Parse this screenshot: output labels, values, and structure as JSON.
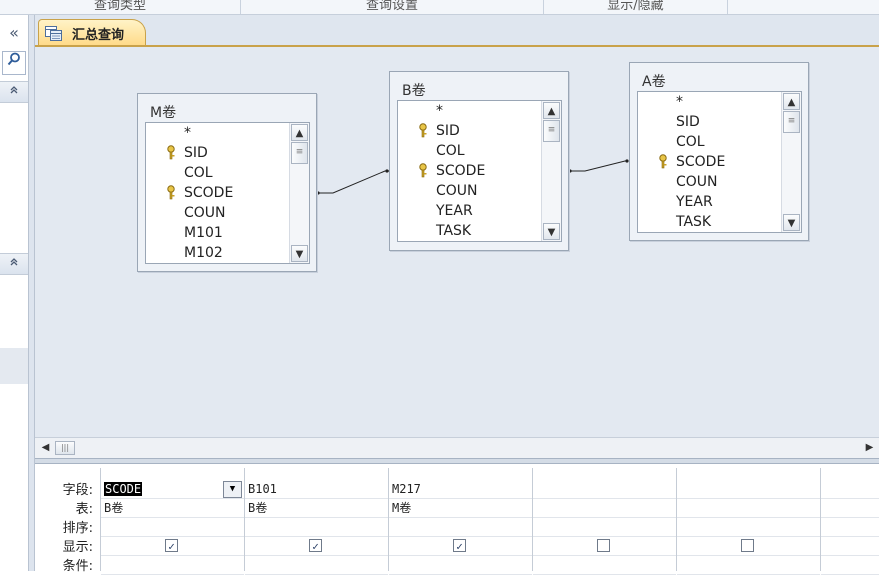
{
  "ribbon": {
    "groups": [
      "查询类型",
      "查询设置",
      "显示/隐藏"
    ]
  },
  "nav": {
    "collapse_icon": "«",
    "search_icon": "search-icon",
    "section_toggle": "⌃"
  },
  "document_tab": {
    "label": "汇总查询",
    "icon": "query-icon"
  },
  "tables": [
    {
      "name": "M卷",
      "fields": [
        "*",
        "SID",
        "COL",
        "SCODE",
        "COUN",
        "M101",
        "M102"
      ],
      "key_fields": [
        "SID",
        "SCODE"
      ]
    },
    {
      "name": "B卷",
      "fields": [
        "*",
        "SID",
        "COL",
        "SCODE",
        "COUN",
        "YEAR",
        "TASK"
      ],
      "key_fields": [
        "SID",
        "SCODE"
      ]
    },
    {
      "name": "A卷",
      "fields": [
        "*",
        "SID",
        "COL",
        "SCODE",
        "COUN",
        "YEAR",
        "TASK"
      ],
      "key_fields": [
        "SCODE"
      ]
    }
  ],
  "grid": {
    "row_labels": [
      "字段:",
      "表:",
      "排序:",
      "显示:",
      "条件:"
    ],
    "columns": [
      {
        "field": "SCODE",
        "table": "B卷",
        "sort": "",
        "show": true
      },
      {
        "field": "B101",
        "table": "B卷",
        "sort": "",
        "show": true
      },
      {
        "field": "M217",
        "table": "M卷",
        "sort": "",
        "show": true
      },
      {
        "field": "",
        "table": "",
        "sort": "",
        "show": false
      },
      {
        "field": "",
        "table": "",
        "sort": "",
        "show": false
      },
      {
        "field": "",
        "table": "",
        "sort": "",
        "show": false
      }
    ],
    "check_mark": "✓"
  },
  "colors": {
    "tab_accent": "#ffd985",
    "design_bg": "#e3e9f1",
    "key_gold": "#c9a227"
  }
}
